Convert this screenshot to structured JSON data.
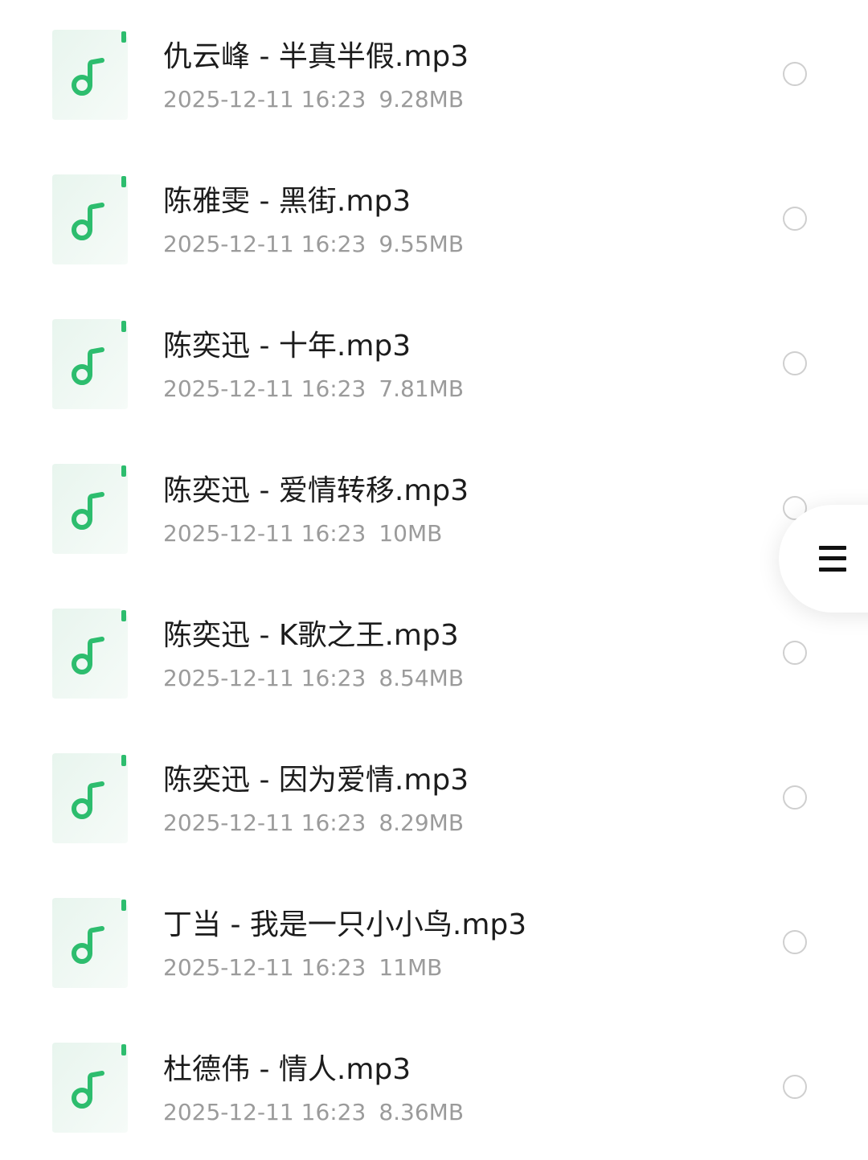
{
  "files": [
    {
      "name": "仇云峰 - 半真半假.mp3",
      "date": "2025-12-11 16:23",
      "size": "9.28MB",
      "icon": "music-file-icon",
      "selected": false
    },
    {
      "name": "陈雅雯 - 黑街.mp3",
      "date": "2025-12-11 16:23",
      "size": "9.55MB",
      "icon": "music-file-icon",
      "selected": false
    },
    {
      "name": "陈奕迅 - 十年.mp3",
      "date": "2025-12-11 16:23",
      "size": "7.81MB",
      "icon": "music-file-icon",
      "selected": false
    },
    {
      "name": "陈奕迅 - 爱情转移.mp3",
      "date": "2025-12-11 16:23",
      "size": "10MB",
      "icon": "music-file-icon",
      "selected": false
    },
    {
      "name": "陈奕迅 - K歌之王.mp3",
      "date": "2025-12-11 16:23",
      "size": "8.54MB",
      "icon": "music-file-icon",
      "selected": false
    },
    {
      "name": "陈奕迅 - 因为爱情.mp3",
      "date": "2025-12-11 16:23",
      "size": "8.29MB",
      "icon": "music-file-icon",
      "selected": false
    },
    {
      "name": "丁当 - 我是一只小小鸟.mp3",
      "date": "2025-12-11 16:23",
      "size": "11MB",
      "icon": "music-file-icon",
      "selected": false
    },
    {
      "name": "杜德伟 - 情人.mp3",
      "date": "2025-12-11 16:23",
      "size": "8.36MB",
      "icon": "music-file-icon",
      "selected": false
    }
  ],
  "floating_menu": {
    "icon": "hamburger-menu-icon"
  },
  "colors": {
    "accent": "#2dbd6e",
    "icon_bg": "#e8f5ee",
    "title_text": "#1c1c1c",
    "meta_text": "#9b9b9b",
    "radio_border": "#cfcfcf"
  }
}
